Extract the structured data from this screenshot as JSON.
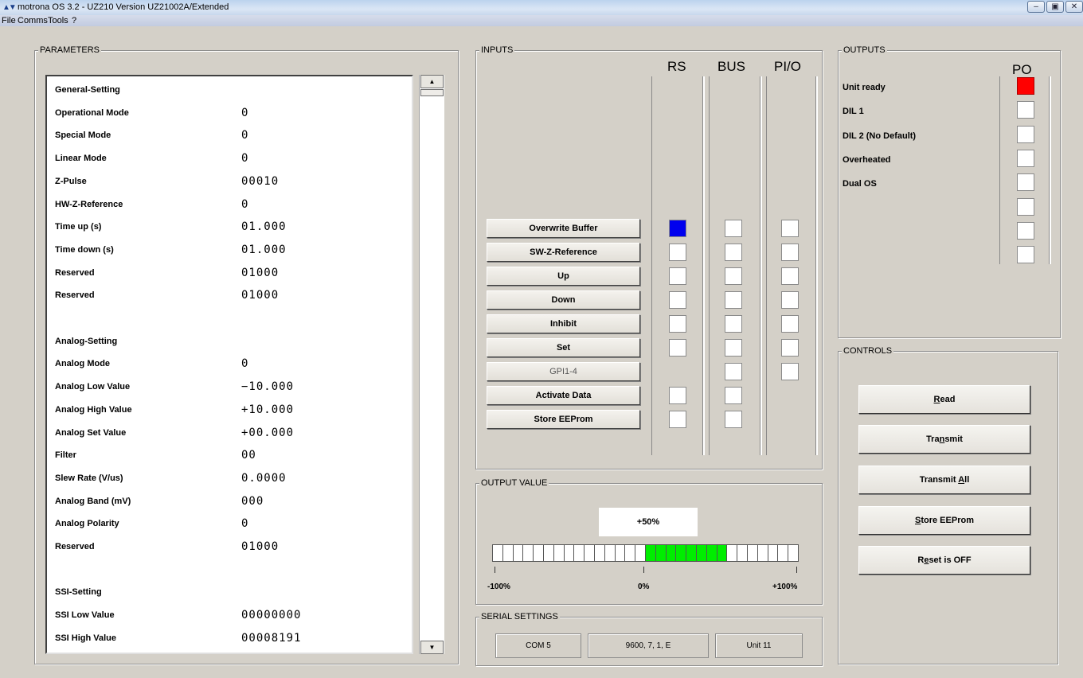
{
  "window": {
    "title": "motrona OS 3.2  -  UZ210 Version UZ21002A/Extended",
    "minimize": "–",
    "maximize": "▣",
    "close": "✕"
  },
  "menu": [
    "File",
    "Comms",
    "Tools",
    "?"
  ],
  "parameters": {
    "title": "PARAMETERS",
    "rows": [
      {
        "label": "General-Setting",
        "value": ""
      },
      {
        "label": "Operational Mode",
        "value": "0"
      },
      {
        "label": "Special Mode",
        "value": "0"
      },
      {
        "label": "Linear Mode",
        "value": "0"
      },
      {
        "label": "Z-Pulse",
        "value": "00010"
      },
      {
        "label": "HW-Z-Reference",
        "value": "0"
      },
      {
        "label": "Time up (s)",
        "value": "01.000"
      },
      {
        "label": "Time down (s)",
        "value": "01.000"
      },
      {
        "label": "Reserved",
        "value": "01000"
      },
      {
        "label": "Reserved",
        "value": "01000"
      },
      {
        "label": "",
        "value": ""
      },
      {
        "label": "Analog-Setting",
        "value": ""
      },
      {
        "label": "Analog Mode",
        "value": "0"
      },
      {
        "label": "Analog Low Value",
        "value": "−10.000"
      },
      {
        "label": "Analog High Value",
        "value": "+10.000"
      },
      {
        "label": "Analog Set Value",
        "value": "+00.000"
      },
      {
        "label": "Filter",
        "value": "00"
      },
      {
        "label": "Slew Rate (V/us)",
        "value": "0.0000"
      },
      {
        "label": "Analog Band (mV)",
        "value": "000"
      },
      {
        "label": "Analog Polarity",
        "value": "0"
      },
      {
        "label": "Reserved",
        "value": "01000"
      },
      {
        "label": "",
        "value": ""
      },
      {
        "label": "SSI-Setting",
        "value": ""
      },
      {
        "label": "SSI Low Value",
        "value": "00000000"
      },
      {
        "label": "SSI High Value",
        "value": "00008191"
      }
    ]
  },
  "inputs": {
    "title": "INPUTS",
    "columns": [
      "RS",
      "BUS",
      "PI/O"
    ],
    "rows": [
      {
        "label": "Overwrite Buffer",
        "enabled": true,
        "rs": "active",
        "bus": "off",
        "pio": "off"
      },
      {
        "label": "SW-Z-Reference",
        "enabled": true,
        "rs": "off",
        "bus": "off",
        "pio": "off"
      },
      {
        "label": "Up",
        "enabled": true,
        "rs": "off",
        "bus": "off",
        "pio": "off"
      },
      {
        "label": "Down",
        "enabled": true,
        "rs": "off",
        "bus": "off",
        "pio": "off"
      },
      {
        "label": "Inhibit",
        "enabled": true,
        "rs": "off",
        "bus": "off",
        "pio": "off"
      },
      {
        "label": "Set",
        "enabled": true,
        "rs": "off",
        "bus": "off",
        "pio": "off"
      },
      {
        "label": "GPI1-4",
        "enabled": false,
        "rs": "none",
        "bus": "off",
        "pio": "off"
      },
      {
        "label": "Activate Data",
        "enabled": true,
        "rs": "off",
        "bus": "off",
        "pio": "none"
      },
      {
        "label": "Store EEProm",
        "enabled": true,
        "rs": "off",
        "bus": "off",
        "pio": "none"
      }
    ],
    "active_color": "#0000ee"
  },
  "outputs": {
    "title": "OUTPUTS",
    "column": "PO",
    "labels": [
      "Unit ready",
      "DIL 1",
      "DIL 2 (No Default)",
      "Overheated",
      "Dual OS"
    ],
    "indicator_states": [
      "on",
      "off",
      "off",
      "off",
      "off",
      "off",
      "off",
      "off"
    ],
    "on_color": "#ff0000"
  },
  "controls": {
    "title": "CONTROLS",
    "buttons": [
      {
        "pre": "",
        "key": "R",
        "post": "ead"
      },
      {
        "pre": "Tra",
        "key": "n",
        "post": "smit"
      },
      {
        "pre": "Transmit ",
        "key": "A",
        "post": "ll"
      },
      {
        "pre": "",
        "key": "S",
        "post": "tore EEProm"
      },
      {
        "pre": "R",
        "key": "e",
        "post": "set is OFF"
      }
    ]
  },
  "output_value": {
    "title": "OUTPUT VALUE",
    "readout": "+50%",
    "percent": 50,
    "segments": 30,
    "fill_color": "#00ee00",
    "scale": [
      "-100%",
      "0%",
      "+100%"
    ]
  },
  "serial": {
    "title": "SERIAL SETTINGS",
    "port": "COM 5",
    "params": "9600, 7, 1, E",
    "unit": "Unit 11"
  }
}
